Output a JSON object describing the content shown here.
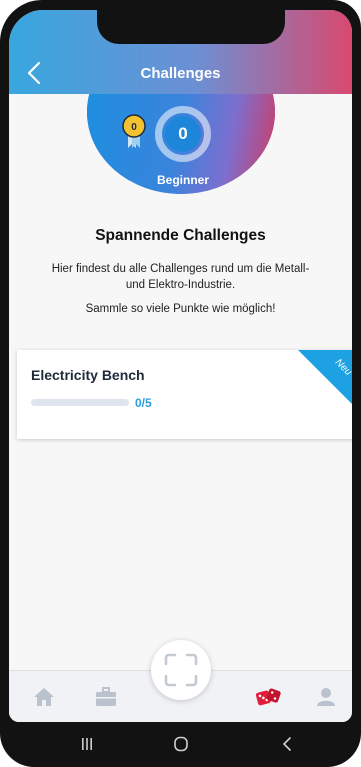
{
  "header": {
    "title": "Challenges"
  },
  "level": {
    "points": "0",
    "name": "Beginner",
    "medal_number": "0"
  },
  "intro": {
    "heading": "Spannende Challenges",
    "description": "Hier findest du alle Challenges rund um die Metall- und Elektro-Industrie.",
    "cta": "Sammle so viele Punkte wie möglich!"
  },
  "challenges": [
    {
      "title": "Electricity Bench",
      "progress_text": "0/5",
      "progress": 0,
      "badge": "Neu"
    }
  ],
  "bottom_nav": {
    "items": [
      "home-icon",
      "briefcase-icon",
      "scan-icon",
      "dice-icon",
      "profile-icon"
    ]
  },
  "colors": {
    "accent": "#2a9fe0",
    "brand_pink": "#d23a62",
    "dice": "#e21d3a"
  }
}
